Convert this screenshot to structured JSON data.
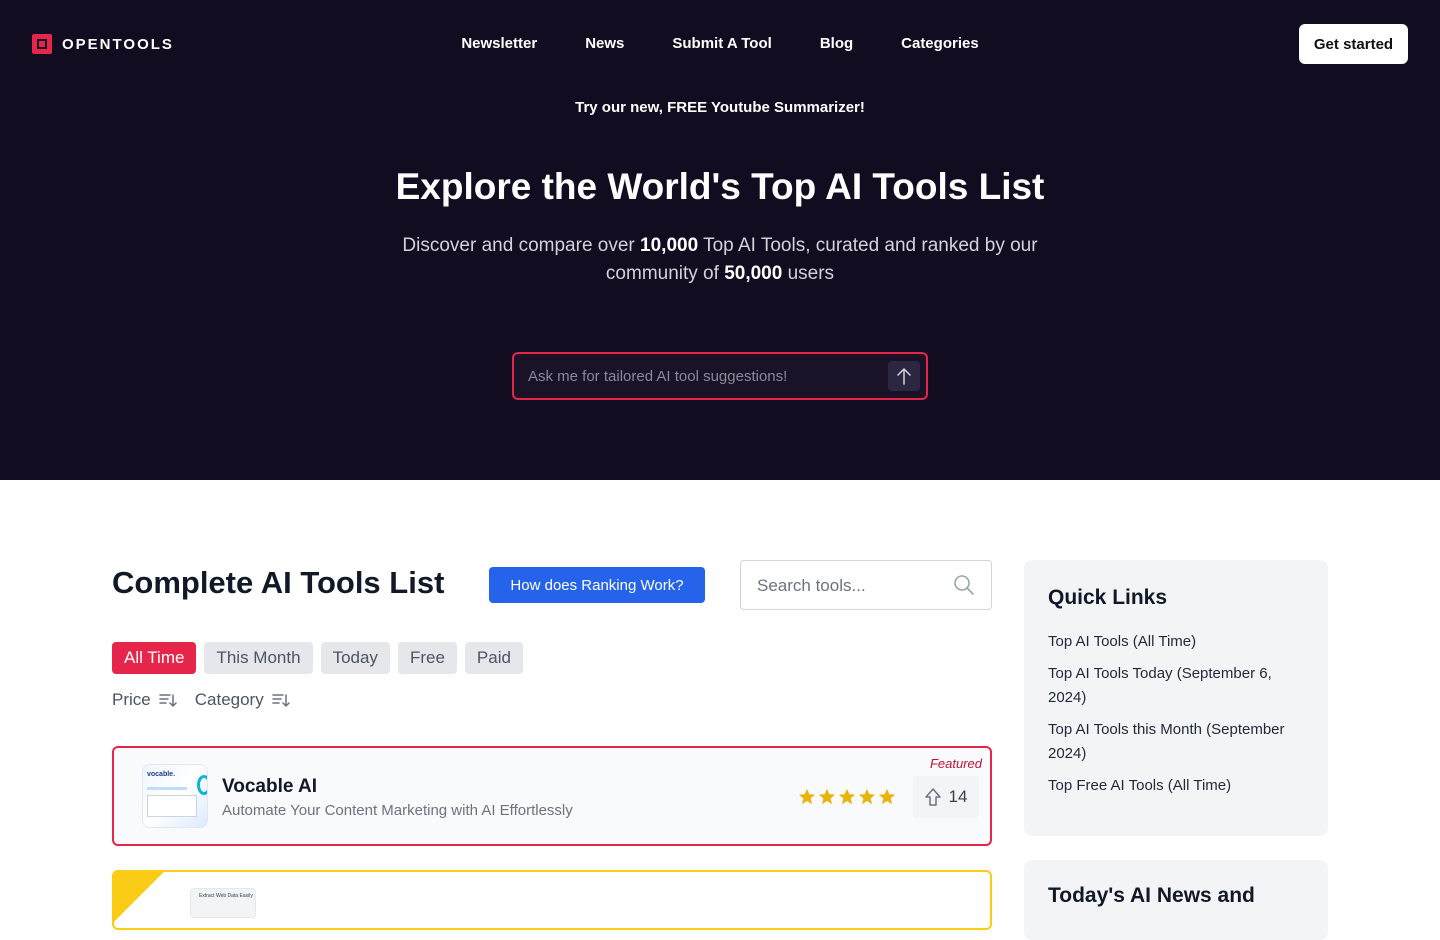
{
  "brand": {
    "name": "OPENTOOLS",
    "accent": "#e5264a",
    "hero_bg": "#120c20"
  },
  "nav": {
    "items": [
      "Newsletter",
      "News",
      "Submit A Tool",
      "Blog",
      "Categories"
    ],
    "cta": "Get started"
  },
  "hero": {
    "promo": "Try our new, FREE Youtube Summarizer!",
    "title": "Explore the World's Top AI Tools List",
    "sub_1": "Discover and compare over ",
    "sub_num_tools": "10,000",
    "sub_2": " Top AI Tools, curated and ranked by our community of ",
    "sub_num_users": "50,000",
    "sub_3": " users",
    "ask_placeholder": "Ask me for tailored AI tool suggestions!"
  },
  "list": {
    "title": "Complete AI Tools List",
    "ranking_button": "How does Ranking Work?",
    "search_placeholder": "Search tools...",
    "filters": [
      "All Time",
      "This Month",
      "Today",
      "Free",
      "Paid"
    ],
    "active_filter": "All Time",
    "sorts": [
      "Price",
      "Category"
    ],
    "cards": [
      {
        "name": "Vocable AI",
        "description": "Automate Your Content Marketing with AI Effortlessly",
        "badge": "Featured",
        "thumb_text": "vocable.",
        "rating": 5,
        "votes": "14"
      },
      {
        "thumb_text": "Extract Web Data Easily"
      }
    ]
  },
  "sidebar": {
    "quick_links_title": "Quick Links",
    "quick_links": [
      "Top AI Tools (All Time)",
      "Top AI Tools Today (September 6, 2024)",
      "Top AI Tools this Month (September 2024)",
      "Top Free AI Tools (All Time)"
    ],
    "news_title": "Today's AI News and"
  }
}
